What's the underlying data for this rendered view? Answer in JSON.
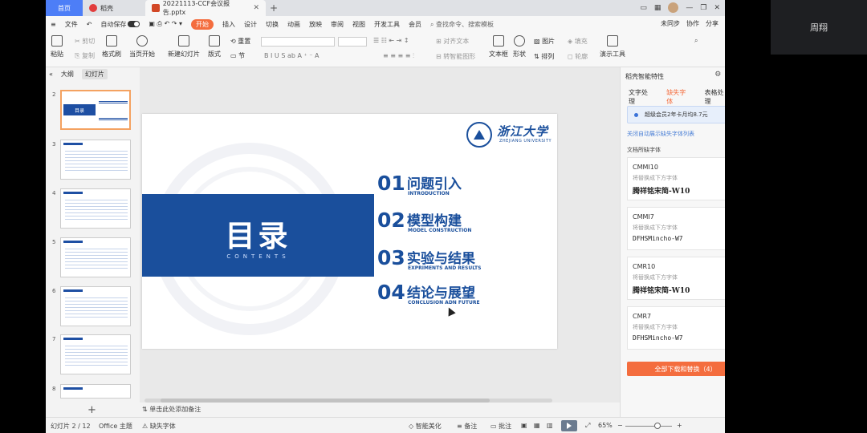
{
  "video": {
    "participant_name": "周翔"
  },
  "tabs": {
    "home": "首页",
    "daoke": "稻壳",
    "doc": "20221113-CCF会议报告.pptx",
    "add": "+"
  },
  "menubar": {
    "file": "文件",
    "autosave": "自动保存",
    "items": [
      "开始",
      "插入",
      "设计",
      "切换",
      "动画",
      "放映",
      "审阅",
      "视图",
      "开发工具",
      "会员"
    ],
    "search": "查找命令、搜索模板",
    "right": [
      "未同步",
      "协作",
      "分享"
    ]
  },
  "ribbon": {
    "paste": "粘贴",
    "cut": "剪切",
    "copy": "复制",
    "format_painter": "格式刷",
    "start_show": "当页开始",
    "new_slide": "新建幻灯片",
    "layout": "版式",
    "section": "节",
    "reset": "重置",
    "textbox": "文本框",
    "shape": "形状",
    "arrange": "排列",
    "image": "图片",
    "fill": "填充",
    "outline": "轮廓",
    "presenter": "演示工具",
    "align_text": "对齐文本",
    "smartart": "转智能图形"
  },
  "left_panel": {
    "tab_outline": "大纲",
    "tab_slides": "幻灯片",
    "thumb_title": "目录",
    "slide_numbers": [
      "2",
      "3",
      "4",
      "5",
      "6",
      "7",
      "8"
    ],
    "add": "+"
  },
  "slide": {
    "title": "目录",
    "subtitle": "CONTENTS",
    "logo_cn": "浙江大学",
    "logo_en": "ZHEJIANG UNIVERSITY",
    "toc": [
      {
        "num": "01",
        "title": "问题引入",
        "en": "INTRODUCTION"
      },
      {
        "num": "02",
        "title": "模型构建",
        "en": "MODEL CONSTRUCTION"
      },
      {
        "num": "03",
        "title": "实验与结果",
        "en": "EXPRIMENTS AND RESULTS"
      },
      {
        "num": "04",
        "title": "结论与展望",
        "en": "CONCLUSION ADN FUTURE"
      }
    ]
  },
  "notes": {
    "placeholder": "单击此处添加备注"
  },
  "right_panel": {
    "title": "稻壳智能特性",
    "tabs": [
      "文字处理",
      "缺失字体",
      "表格处理"
    ],
    "promo": "超级会员2年卡月均8.7元",
    "link": "关闭自动展示缺失字体列表",
    "section": "文档所缺字体",
    "fonts": [
      {
        "name": "CMMI10",
        "hint": "将替换成下方字体",
        "replacement": "腾祥铭宋简-W10"
      },
      {
        "name": "CMMI7",
        "hint": "将替换成下方字体",
        "replacement": "DFHSMincho-W7"
      },
      {
        "name": "CMR10",
        "hint": "将替换成下方字体",
        "replacement": "腾祥铭宋简-W10"
      },
      {
        "name": "CMR7",
        "hint": "将替换成下方字体",
        "replacement": "DFHSMincho-W7"
      }
    ],
    "action": "全部下载和替换（4）"
  },
  "statusbar": {
    "slide_counter": "幻灯片 2 / 12",
    "theme": "Office 主题",
    "missing_font": "缺失字体",
    "beautify": "智能美化",
    "notes": "备注",
    "comments": "批注",
    "zoom": "65%",
    "minus": "−",
    "plus": "+"
  },
  "colors": {
    "brand_blue": "#1a4f9c",
    "accent_orange": "#f46d3e",
    "tab_blue": "#4d7ef7"
  }
}
